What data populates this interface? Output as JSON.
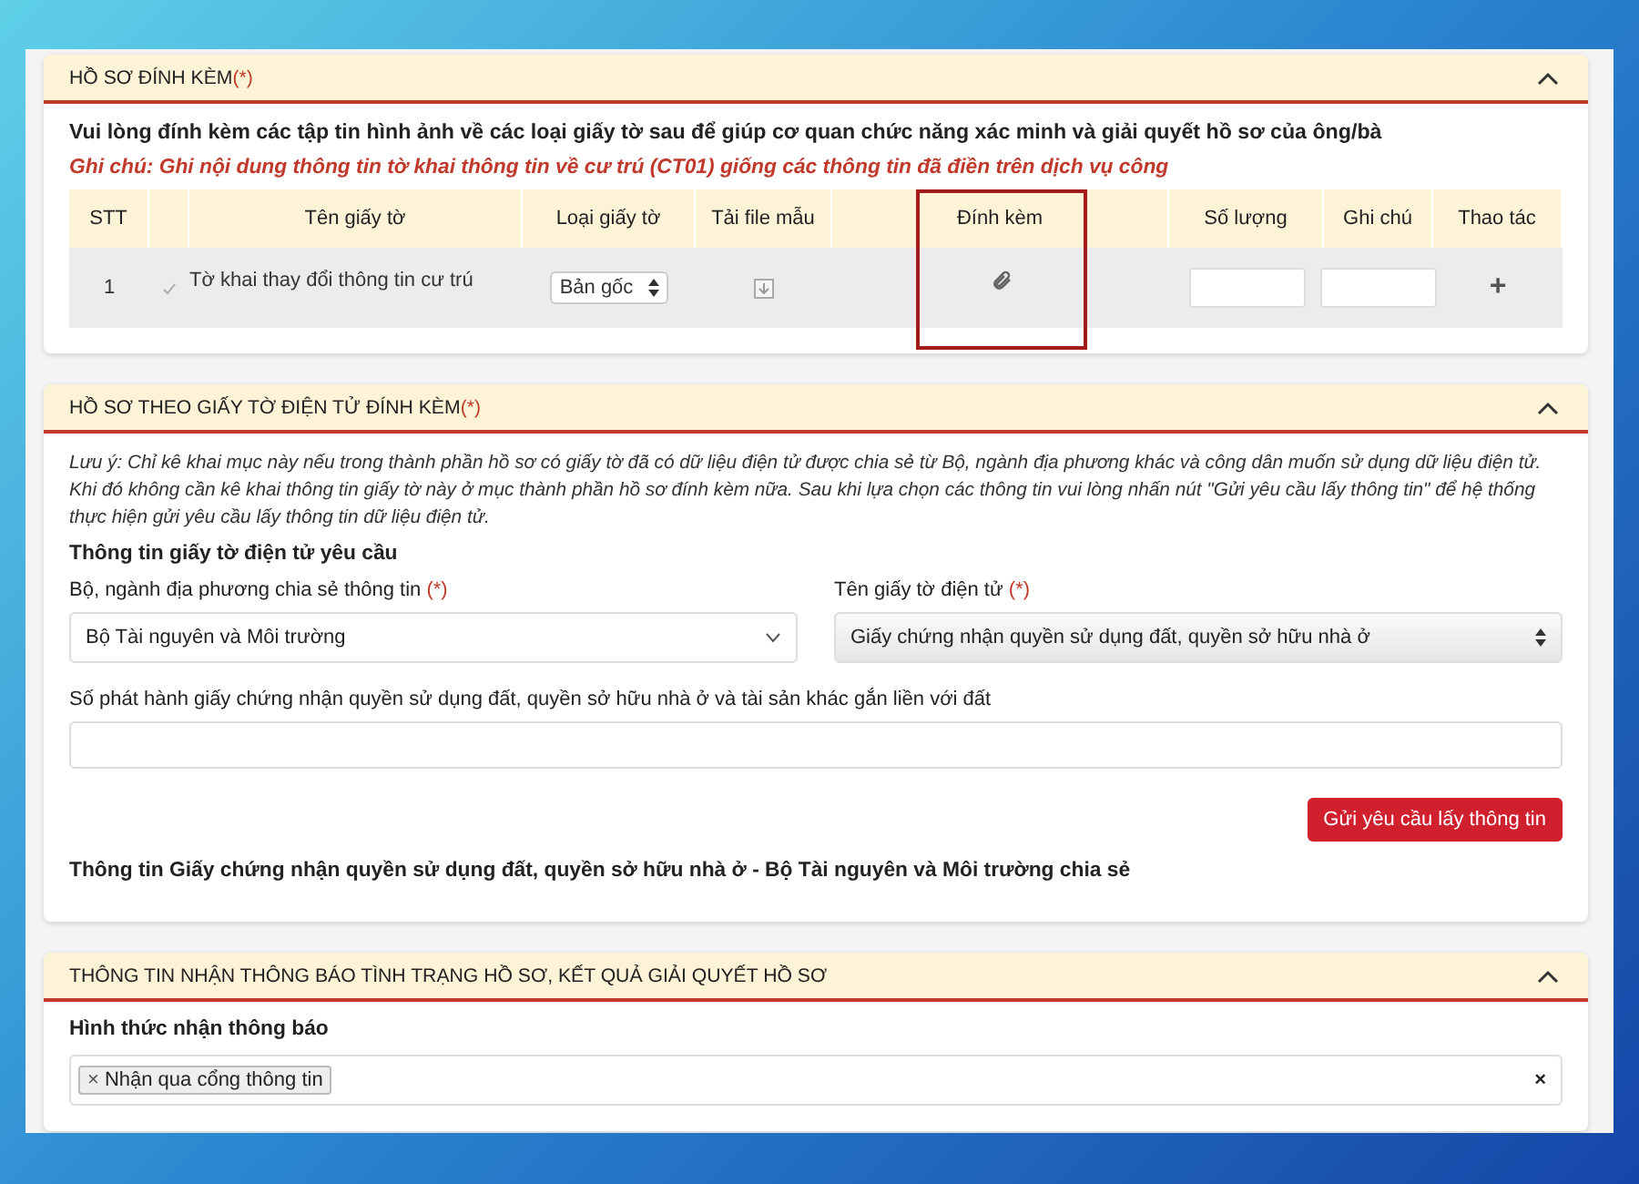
{
  "sections": [
    {
      "title": "HỒ SƠ ĐÍNH KÈM",
      "required_mark": "(*)",
      "expanded": true
    },
    {
      "title": "HỒ SƠ THEO GIẤY TỜ ĐIỆN TỬ ĐÍNH KÈM",
      "required_mark": "(*)",
      "expanded": true
    },
    {
      "title": "THÔNG TIN NHẬN THÔNG BÁO TÌNH TRẠNG HỒ SƠ, KẾT QUẢ GIẢI QUYẾT HỒ SƠ",
      "expanded": true
    }
  ],
  "attachments": {
    "instruction": "Vui lòng đính kèm các tập tin hình ảnh về các loại giấy tờ sau để giúp cơ quan chức năng xác minh và giải quyết hồ sơ của ông/bà",
    "note": "Ghi chú: Ghi nội dung thông tin tờ khai thông tin về cư trú (CT01) giống các thông tin đã điền trên dịch vụ công",
    "columns": [
      {
        "label": "STT",
        "highlighted": false
      },
      {
        "label": "Tên giấy tờ",
        "highlighted": false
      },
      {
        "label": "Loại giấy tờ",
        "highlighted": false
      },
      {
        "label": "Tải file mẫu",
        "highlighted": false
      },
      {
        "label": "Đính kèm",
        "highlighted": true
      },
      {
        "label": "Số lượng",
        "highlighted": false
      },
      {
        "label": "Ghi chú",
        "highlighted": false
      },
      {
        "label": "Thao tác",
        "highlighted": false
      }
    ],
    "rows": [
      {
        "stt": "1",
        "checked": true,
        "name": "Tờ khai thay đổi thông tin cư trú",
        "type": "Bản gốc",
        "add": "+"
      }
    ]
  },
  "electronic": {
    "note": "Lưu ý: Chỉ kê khai mục này nếu trong thành phần hồ sơ có giấy tờ đã có dữ liệu điện tử được chia sẻ từ Bộ, ngành địa phương khác và công dân muốn sử dụng dữ liệu điện tử. Khi đó không cần kê khai thông tin giấy tờ này ở mục thành phần hồ sơ đính kèm nữa. Sau khi lựa chọn các thông tin vui lòng nhấn nút \"Gửi yêu cầu lấy thông tin\" để hệ thống thực hiện gửi yêu cầu lấy thông tin dữ liệu điện tử.",
    "subheading": "Thông tin giấy tờ điện tử yêu cầu",
    "ministry": {
      "label": "Bộ, ngành địa phương chia sẻ thông tin",
      "required_mark": "(*)",
      "value": "Bộ Tài nguyên và Môi trường"
    },
    "document": {
      "label": "Tên giấy tờ điện tử",
      "required_mark": "(*)",
      "value": "Giấy chứng nhận quyền sử dụng đất, quyền sở hữu nhà ở"
    },
    "number": {
      "label": "Số phát hành giấy chứng nhận quyền sử dụng đất, quyền sở hữu nhà ở và tài sản khác gắn liền với đất"
    },
    "button": "Gửi yêu cầu lấy thông tin",
    "result_heading": "Thông tin Giấy chứng nhận quyền sử dụng đất, quyền sở hữu nhà ở - Bộ Tài nguyên và Môi trường chia sẻ"
  },
  "notification": {
    "label": "Hình thức nhận thông báo",
    "tags": [
      "Nhận qua cổng thông tin"
    ],
    "tag_remove": "×",
    "clear": "×"
  }
}
